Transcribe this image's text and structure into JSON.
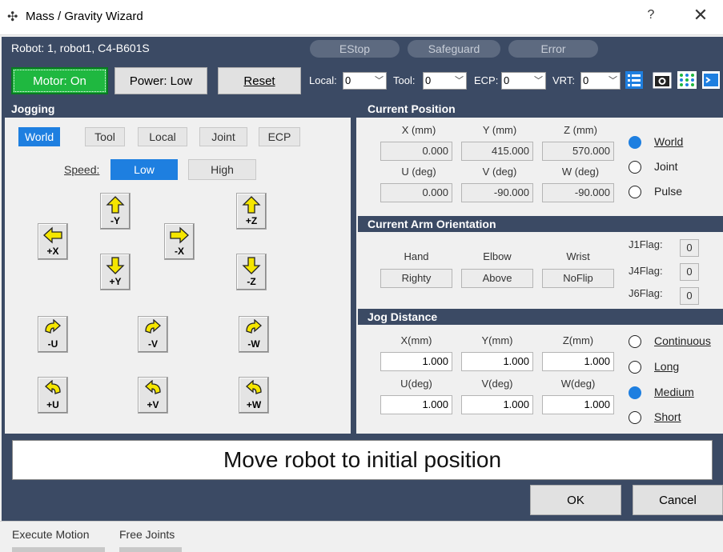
{
  "title": "Mass / Gravity Wizard",
  "titlebar": {
    "help": "?",
    "close": "✕"
  },
  "robot": "Robot: 1, robot1, C4-B601S",
  "indicators": [
    "EStop",
    "Safeguard",
    "Error"
  ],
  "toolbar": {
    "motor": "Motor: On",
    "power": "Power: Low",
    "reset": "Reset",
    "local_label": "Local:",
    "local_value": "0",
    "tool_label": "Tool:",
    "tool_value": "0",
    "ecp_label": "ECP:",
    "ecp_value": "0",
    "vrt_label": "VRT:",
    "vrt_value": "0",
    "icons": [
      "list-icon",
      "camera-icon",
      "io-monitor-icon",
      "terminal-icon"
    ]
  },
  "jogging": {
    "header": "Jogging",
    "modes": [
      "World",
      "Tool",
      "Local",
      "Joint",
      "ECP"
    ],
    "selected_mode": "World",
    "speed_label": "Speed:",
    "speeds": [
      "Low",
      "High"
    ],
    "selected_speed": "Low",
    "buttons": {
      "py": "-Y",
      "px_left": "+X",
      "ny": "+Y",
      "nx_right": "-X",
      "pz": "+Z",
      "nz": "-Z",
      "nu": "-U",
      "nv": "-V",
      "nw": "-W",
      "pu": "+U",
      "pv": "+V",
      "pw": "+W"
    }
  },
  "current_position": {
    "header": "Current Position",
    "labels": [
      "X (mm)",
      "Y (mm)",
      "Z (mm)",
      "U (deg)",
      "V (deg)",
      "W (deg)"
    ],
    "values": [
      "0.000",
      "415.000",
      "570.000",
      "0.000",
      "-90.000",
      "-90.000"
    ],
    "radios": [
      "World",
      "Joint",
      "Pulse"
    ],
    "selected": "World"
  },
  "arm_orientation": {
    "header": "Current Arm Orientation",
    "labels": [
      "Hand",
      "Elbow",
      "Wrist"
    ],
    "values": [
      "Righty",
      "Above",
      "NoFlip"
    ],
    "flags": [
      {
        "label": "J1Flag:",
        "value": "0"
      },
      {
        "label": "J4Flag:",
        "value": "0"
      },
      {
        "label": "J6Flag:",
        "value": "0"
      }
    ]
  },
  "jog_distance": {
    "header": "Jog Distance",
    "labels": [
      "X(mm)",
      "Y(mm)",
      "Z(mm)",
      "U(deg)",
      "V(deg)",
      "W(deg)"
    ],
    "values": [
      "1.000",
      "1.000",
      "1.000",
      "1.000",
      "1.000",
      "1.000"
    ],
    "radios": [
      "Continuous",
      "Long",
      "Medium",
      "Short"
    ],
    "selected": "Medium"
  },
  "message": "Move robot to initial position",
  "ok": "OK",
  "cancel": "Cancel",
  "bottom_tabs": [
    "Execute Motion",
    "Free Joints"
  ],
  "colors": {
    "panel": "#3b4a64",
    "accent": "#1e7fe0",
    "motor_on": "#1fb840",
    "arrow": "#f5e600"
  }
}
